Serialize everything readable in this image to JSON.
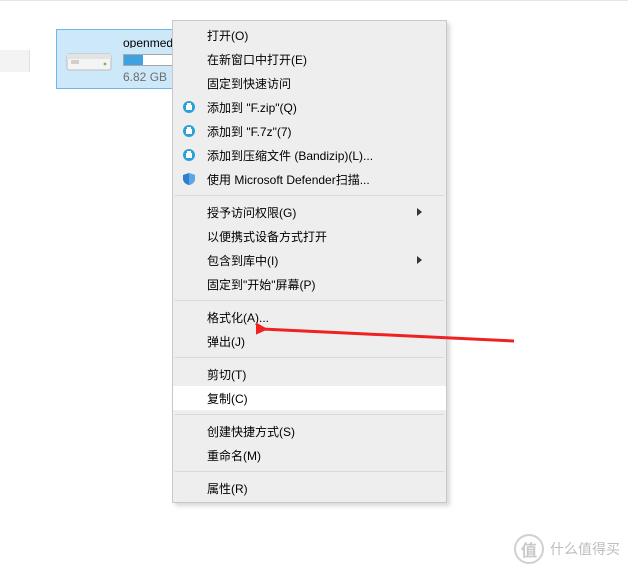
{
  "drive": {
    "name": "openmed...",
    "size_text": "6.82 GB",
    "fill_pct": 22
  },
  "menu": {
    "items": [
      {
        "section": 0,
        "label": "打开(O)",
        "icon": null,
        "submenu": false
      },
      {
        "section": 0,
        "label": "在新窗口中打开(E)",
        "icon": null,
        "submenu": false
      },
      {
        "section": 0,
        "label": "固定到快速访问",
        "icon": null,
        "submenu": false
      },
      {
        "section": 0,
        "label": "添加到 \"F.zip\"(Q)",
        "icon": "bandizip",
        "submenu": false
      },
      {
        "section": 0,
        "label": "添加到 \"F.7z\"(7)",
        "icon": "bandizip",
        "submenu": false
      },
      {
        "section": 0,
        "label": "添加到压缩文件 (Bandizip)(L)...",
        "icon": "bandizip",
        "submenu": false
      },
      {
        "section": 0,
        "label": "使用 Microsoft Defender扫描...",
        "icon": "defender",
        "submenu": false
      },
      {
        "section": 1,
        "label": "授予访问权限(G)",
        "icon": null,
        "submenu": true
      },
      {
        "section": 1,
        "label": "以便携式设备方式打开",
        "icon": null,
        "submenu": false
      },
      {
        "section": 1,
        "label": "包含到库中(I)",
        "icon": null,
        "submenu": true
      },
      {
        "section": 1,
        "label": "固定到\"开始\"屏幕(P)",
        "icon": null,
        "submenu": false
      },
      {
        "section": 2,
        "label": "格式化(A)...",
        "icon": null,
        "submenu": false,
        "annot": true
      },
      {
        "section": 2,
        "label": "弹出(J)",
        "icon": null,
        "submenu": false
      },
      {
        "section": 3,
        "label": "剪切(T)",
        "icon": null,
        "submenu": false
      },
      {
        "section": 3,
        "label": "复制(C)",
        "icon": null,
        "submenu": false,
        "hover": true
      },
      {
        "section": 4,
        "label": "创建快捷方式(S)",
        "icon": null,
        "submenu": false
      },
      {
        "section": 4,
        "label": "重命名(M)",
        "icon": null,
        "submenu": false
      },
      {
        "section": 5,
        "label": "属性(R)",
        "icon": null,
        "submenu": false
      }
    ]
  },
  "watermark": {
    "symbol": "值",
    "text": "什么值得买"
  }
}
